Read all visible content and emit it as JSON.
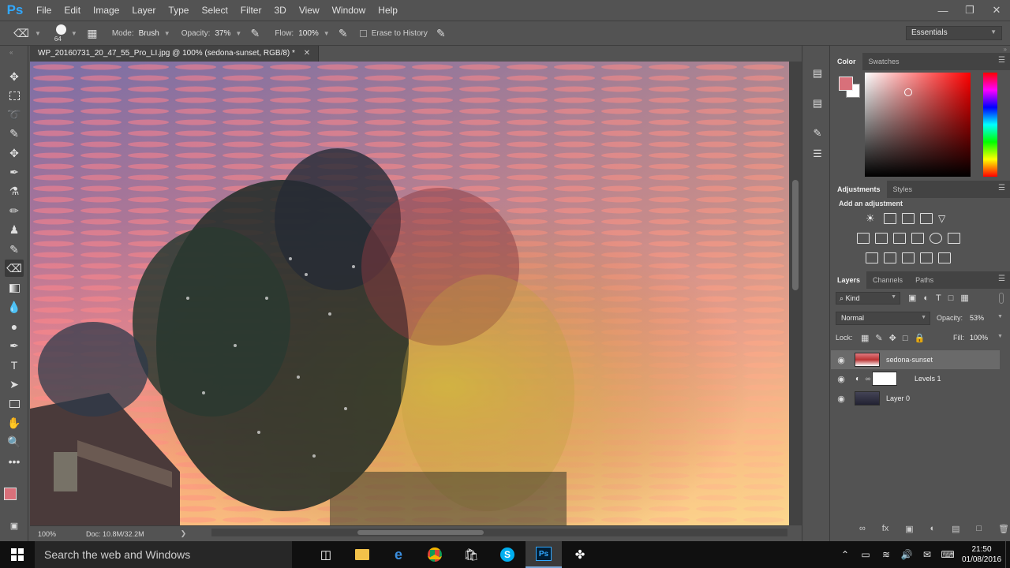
{
  "app": {
    "logo": "Ps"
  },
  "menu": [
    "File",
    "Edit",
    "Image",
    "Layer",
    "Type",
    "Select",
    "Filter",
    "3D",
    "View",
    "Window",
    "Help"
  ],
  "window_controls": {
    "minimize": "minimize-icon",
    "maximize": "maximize-icon",
    "close": "close-icon"
  },
  "options": {
    "brush_size": "64",
    "mode_label": "Mode:",
    "mode_value": "Brush",
    "opacity_label": "Opacity:",
    "opacity_value": "37%",
    "flow_label": "Flow:",
    "flow_value": "100%",
    "erase_history_label": "Erase to History",
    "workspace": "Essentials"
  },
  "document": {
    "tab_title": "WP_20160731_20_47_55_Pro_LI.jpg @ 100% (sedona-sunset, RGB/8) *",
    "zoom": "100%",
    "doc_size": "Doc: 10.8M/32.2M"
  },
  "color_panel": {
    "tabs": [
      "Color",
      "Swatches"
    ],
    "foreground": "#d8707a",
    "background": "#ffffff"
  },
  "adjustments_panel": {
    "tabs": [
      "Adjustments",
      "Styles"
    ],
    "heading": "Add an adjustment"
  },
  "layers_panel": {
    "tabs": [
      "Layers",
      "Channels",
      "Paths"
    ],
    "filter_kind": "Kind",
    "blend_mode": "Normal",
    "opacity_label": "Opacity:",
    "opacity_value": "53%",
    "lock_label": "Lock:",
    "fill_label": "Fill:",
    "fill_value": "100%",
    "layers": [
      {
        "name": "sedona-sunset",
        "selected": true
      },
      {
        "name": "Levels 1",
        "selected": false
      },
      {
        "name": "Layer 0",
        "selected": false
      }
    ]
  },
  "taskbar": {
    "search_placeholder": "Search the web and Windows",
    "time": "21:50",
    "date": "01/08/2016"
  }
}
